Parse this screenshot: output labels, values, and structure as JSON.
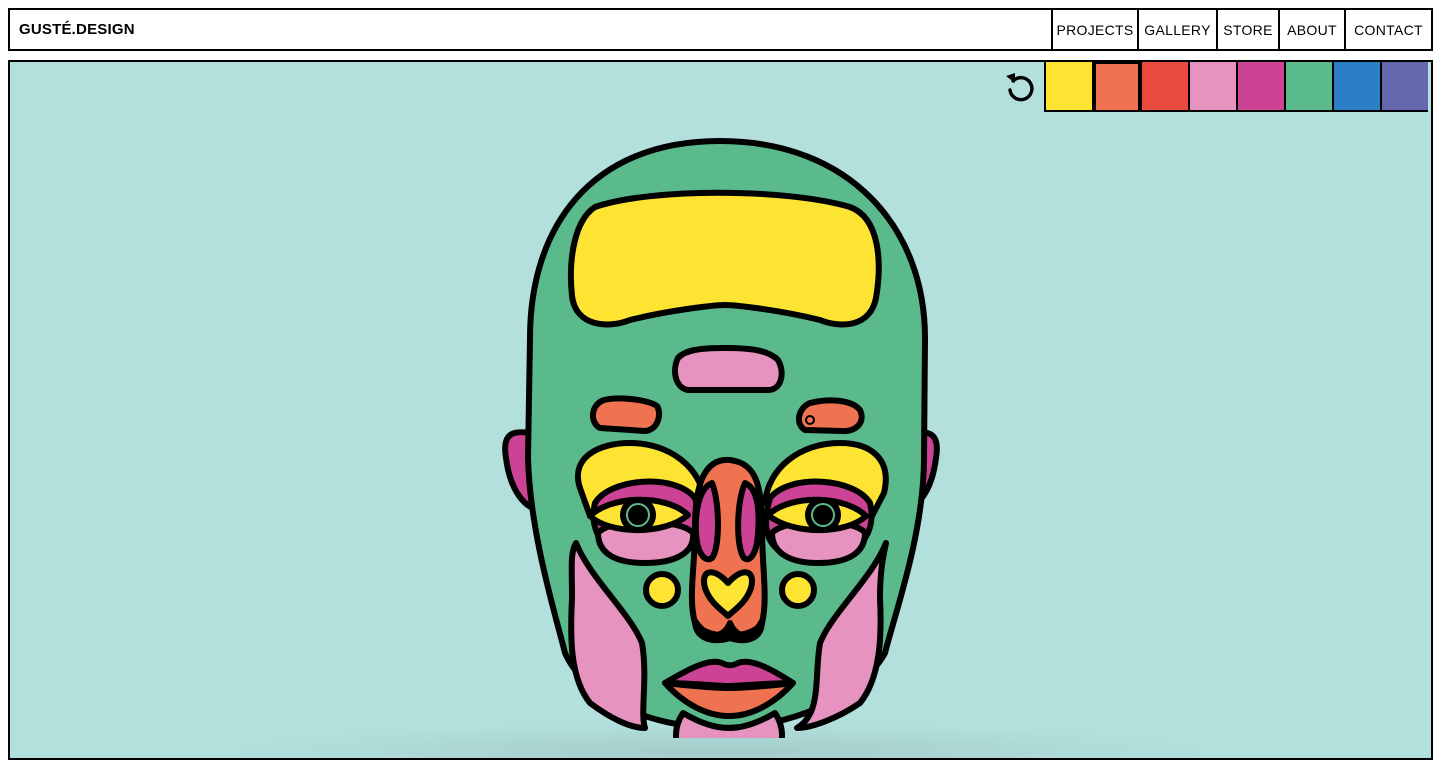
{
  "header": {
    "brand": "GUSTÉ.DESIGN",
    "nav": [
      "PROJECTS",
      "GALLERY",
      "STORE",
      "ABOUT",
      "CONTACT"
    ]
  },
  "toolbar": {
    "reset_icon": "undo-icon"
  },
  "palette": {
    "colors": [
      "#fde332",
      "#ef7350",
      "#ea4a3d",
      "#e793c0",
      "#cc4294",
      "#5bba8c",
      "#2b7fc4",
      "#6567af"
    ],
    "selected_index": 1
  },
  "colors": {
    "background": "#b3e0dd",
    "outline": "#000000",
    "face_base": "#5bba8c",
    "forehead": "#fde332",
    "brows": "#ef7350",
    "glabella": "#e793c0",
    "upper_lids": "#fde332",
    "eye_surround": "#cc4294",
    "under_eyes": "#e793c0",
    "nose": "#ef7350",
    "nose_sides": "#cc4294",
    "nose_tip": "#fde332",
    "cheek_dots": "#fde332",
    "cheeks": "#e793c0",
    "ears": "#cc4294",
    "upper_lip": "#cc4294",
    "lower_lip": "#ef7350",
    "chin": "#e793c0"
  }
}
